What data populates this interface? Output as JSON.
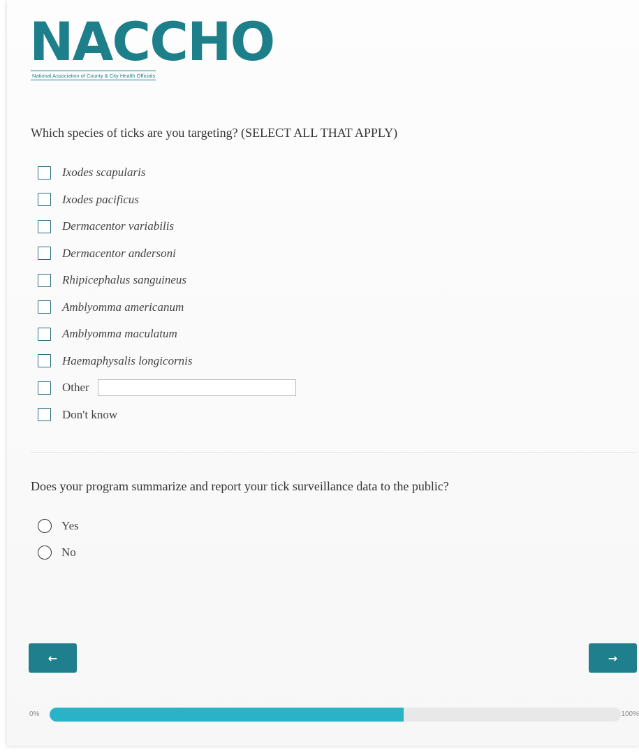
{
  "logo": {
    "wordmark": "NACCHO",
    "tagline": "National Association of County & City Health Officials"
  },
  "question1": {
    "text": "Which species of ticks are you targeting? (SELECT ALL THAT APPLY)",
    "options": [
      "Ixodes scapularis",
      "Ixodes pacificus",
      "Dermacentor variabilis",
      "Dermacentor andersoni",
      "Rhipicephalus sanguineus",
      "Amblyomma americanum",
      "Amblyomma maculatum",
      "Haemaphysalis longicornis",
      "Other",
      "Don't know"
    ],
    "other_value": ""
  },
  "question2": {
    "text": "Does your program summarize and report your tick surveillance data to the public?",
    "options": [
      "Yes",
      "No"
    ]
  },
  "navigation": {
    "prev_icon": "arrow-left-icon",
    "next_icon": "arrow-right-icon",
    "prev_glyph": "←",
    "next_glyph": "→"
  },
  "progress": {
    "start_label": "0%",
    "end_label": "100%",
    "fraction": 0.62
  },
  "colors": {
    "brand": "#1d7f8a",
    "button": "#1f7f8c",
    "progress_fill": "#2ab2c7"
  }
}
